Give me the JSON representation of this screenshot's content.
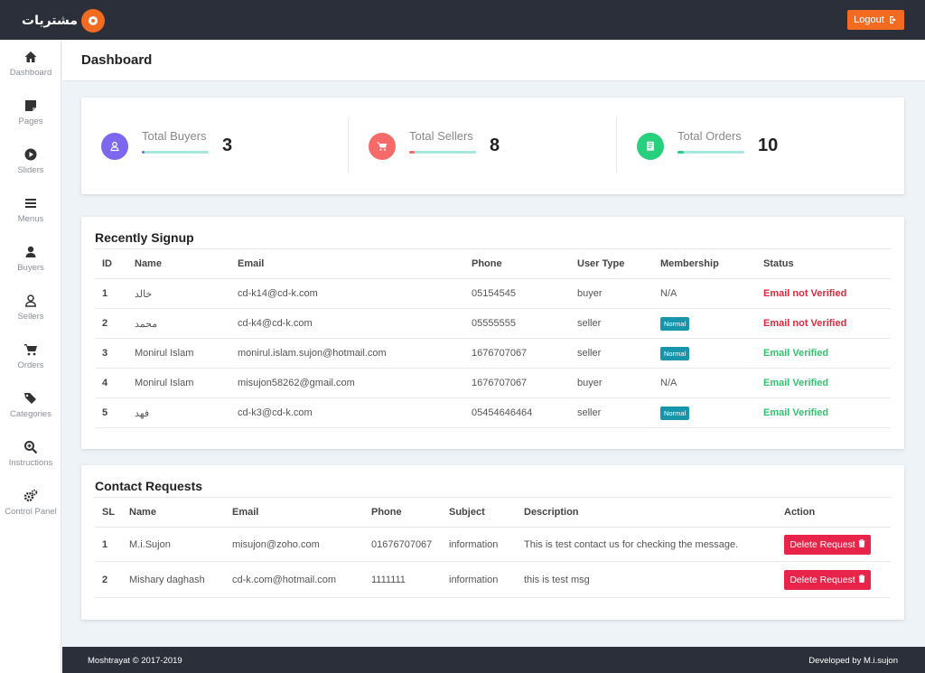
{
  "topbar": {
    "brand_text": "مشتريات",
    "logout_label": "Logout",
    "logout_icon": "sign-out-icon",
    "accent_color": "#f26b21"
  },
  "sidebar": {
    "items": [
      {
        "label": "Dashboard",
        "icon": "home-icon"
      },
      {
        "label": "Pages",
        "icon": "sticky-note-icon"
      },
      {
        "label": "Sliders",
        "icon": "play-circle-icon"
      },
      {
        "label": "Menus",
        "icon": "bars-icon"
      },
      {
        "label": "Buyers",
        "icon": "user-icon"
      },
      {
        "label": "Sellers",
        "icon": "user-outline-icon"
      },
      {
        "label": "Orders",
        "icon": "cart-icon"
      },
      {
        "label": "Categories",
        "icon": "tags-icon"
      },
      {
        "label": "Instructions",
        "icon": "search-plus-icon"
      },
      {
        "label": "Control Panel",
        "icon": "cogs-icon"
      }
    ]
  },
  "header": {
    "title": "Dashboard"
  },
  "stats": [
    {
      "label": "Total Buyers",
      "value": "3",
      "color": "#7b68ee",
      "icon": "user-outline-icon",
      "bar_fill": 0.03,
      "bar_color": "#7b68ee"
    },
    {
      "label": "Total Sellers",
      "value": "8",
      "color": "#f66a6a",
      "icon": "cart-icon",
      "bar_fill": 0.08,
      "bar_color": "#f66a6a"
    },
    {
      "label": "Total Orders",
      "value": "10",
      "color": "#26d07c",
      "icon": "receipt-icon",
      "bar_fill": 0.1,
      "bar_color": "#26d07c"
    }
  ],
  "recent": {
    "title": "Recently Signup",
    "columns": [
      "ID",
      "Name",
      "Email",
      "Phone",
      "User Type",
      "Membership",
      "Status"
    ],
    "rows": [
      {
        "id": "1",
        "name": "خالد",
        "email": "cd-k14@cd-k.com",
        "phone": "05154545",
        "type": "buyer",
        "membership": "N/A",
        "membership_badge": false,
        "status": "Email not Verified",
        "verified": false
      },
      {
        "id": "2",
        "name": "محمد",
        "email": "cd-k4@cd-k.com",
        "phone": "05555555",
        "type": "seller",
        "membership": "Normal",
        "membership_badge": true,
        "status": "Email not Verified",
        "verified": false
      },
      {
        "id": "3",
        "name": "Monirul Islam",
        "email": "monirul.islam.sujon@hotmail.com",
        "phone": "1676707067",
        "type": "seller",
        "membership": "Normal",
        "membership_badge": true,
        "status": "Email Verified",
        "verified": true
      },
      {
        "id": "4",
        "name": "Monirul Islam",
        "email": "misujon58262@gmail.com",
        "phone": "1676707067",
        "type": "buyer",
        "membership": "N/A",
        "membership_badge": false,
        "status": "Email Verified",
        "verified": true
      },
      {
        "id": "5",
        "name": "فهد",
        "email": "cd-k3@cd-k.com",
        "phone": "05454646464",
        "type": "seller",
        "membership": "Normal",
        "membership_badge": true,
        "status": "Email Verified",
        "verified": true
      }
    ]
  },
  "contact": {
    "title": "Contact Requests",
    "columns": [
      "SL",
      "Name",
      "Email",
      "Phone",
      "Subject",
      "Description",
      "Action"
    ],
    "delete_label": "Delete Request",
    "delete_icon": "trash-icon",
    "rows": [
      {
        "sl": "1",
        "name": "M.i.Sujon",
        "email": "misujon@zoho.com",
        "phone": "01676707067",
        "subject": "information",
        "description": "This is test contact us for checking the message."
      },
      {
        "sl": "2",
        "name": "Mishary daghash",
        "email": "cd-k.com@hotmail.com",
        "phone": "1111111",
        "subject": "information",
        "description": "this is test msg"
      }
    ]
  },
  "footer": {
    "left": "Moshtrayat © 2017-2019",
    "right": "Developed by M.i.sujon"
  }
}
